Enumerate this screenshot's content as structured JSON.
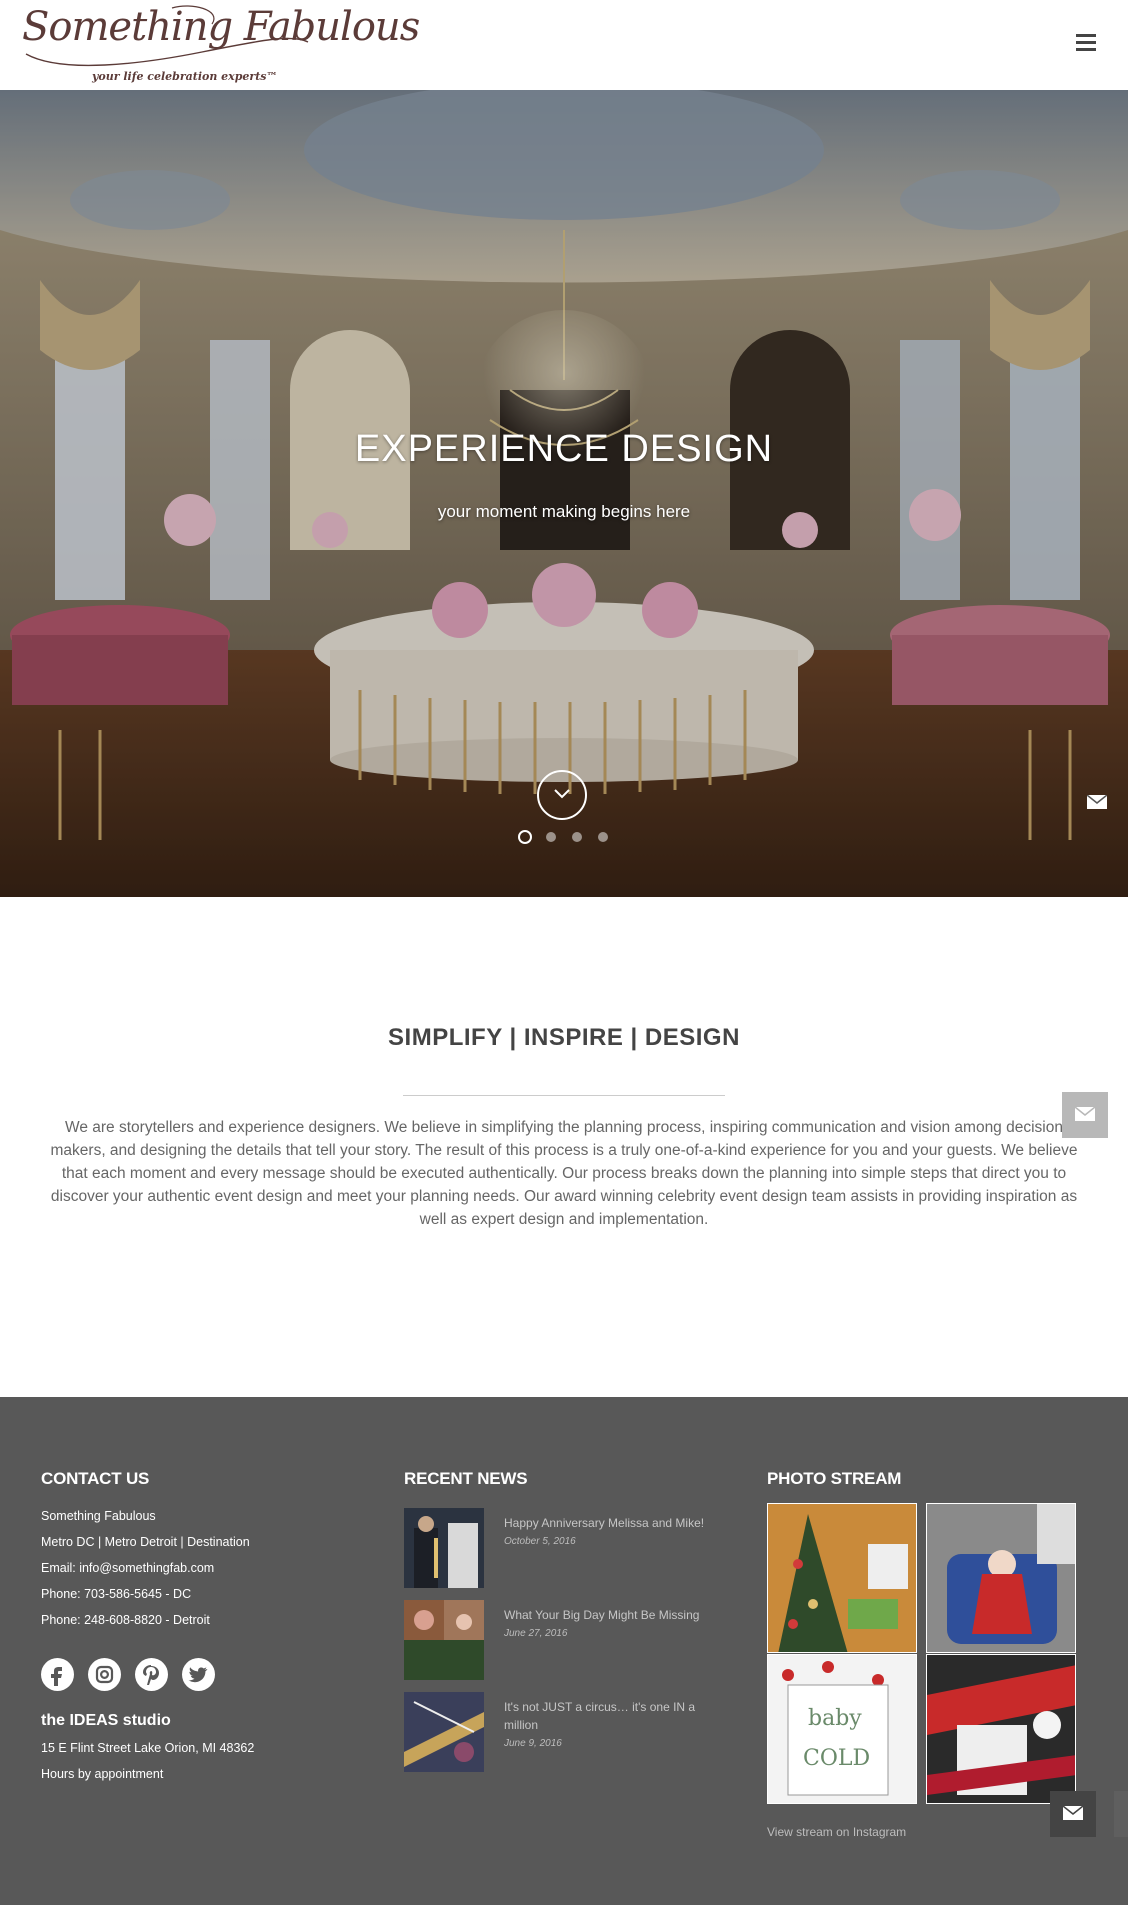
{
  "header": {
    "logo_name": "Something Fabulous",
    "logo_tagline": "your life celebration experts™",
    "menu_icon": "hamburger-menu-icon"
  },
  "hero": {
    "title": "EXPERIENCE DESIGN",
    "subtitle": "your moment making begins here",
    "slide_count": 4,
    "active_slide": 1,
    "scroll_icon": "chevron-down-icon",
    "contact_icon": "envelope-icon"
  },
  "intro": {
    "title": "SIMPLIFY | INSPIRE | DESIGN",
    "body": "We are storytellers and experience designers.  We believe in simplifying the planning process, inspiring communication and vision among decision makers, and designing the details that tell your story.  The result of this process is a truly one-of-a-kind experience for you and your guests.  We believe that each moment and every message should be executed authentically. Our process breaks down the planning into simple steps that direct you to discover your authentic event design and meet your planning needs.  Our award winning celebrity event design team assists in providing inspiration as well as expert design and implementation."
  },
  "footer": {
    "contact": {
      "title": "CONTACT US",
      "lines": [
        "Something Fabulous",
        "Metro DC | Metro Detroit | Destination",
        "Email: info@somethingfab.com",
        "Phone: 703-586-5645 - DC",
        "Phone: 248-608-8820 - Detroit"
      ],
      "social": [
        "facebook-icon",
        "instagram-icon",
        "pinterest-icon",
        "twitter-icon"
      ],
      "studio_title": "the IDEAS studio",
      "studio_lines": [
        "15 E Flint Street Lake Orion, MI 48362",
        "Hours by appointment"
      ]
    },
    "news": {
      "title": "RECENT NEWS",
      "items": [
        {
          "title": "Happy Anniversary Melissa and Mike!",
          "date": "October 5, 2016"
        },
        {
          "title": "What Your Big Day Might Be Missing",
          "date": "June 27, 2016"
        },
        {
          "title": "It's not JUST a circus… it's one IN a million",
          "date": "June 9, 2016"
        }
      ]
    },
    "photos": {
      "title": "PHOTO STREAM",
      "link": "View stream on Instagram"
    }
  },
  "colors": {
    "footer_bg": "#585858",
    "heading_text": "#444444",
    "logo_brown": "#5b3b38"
  }
}
